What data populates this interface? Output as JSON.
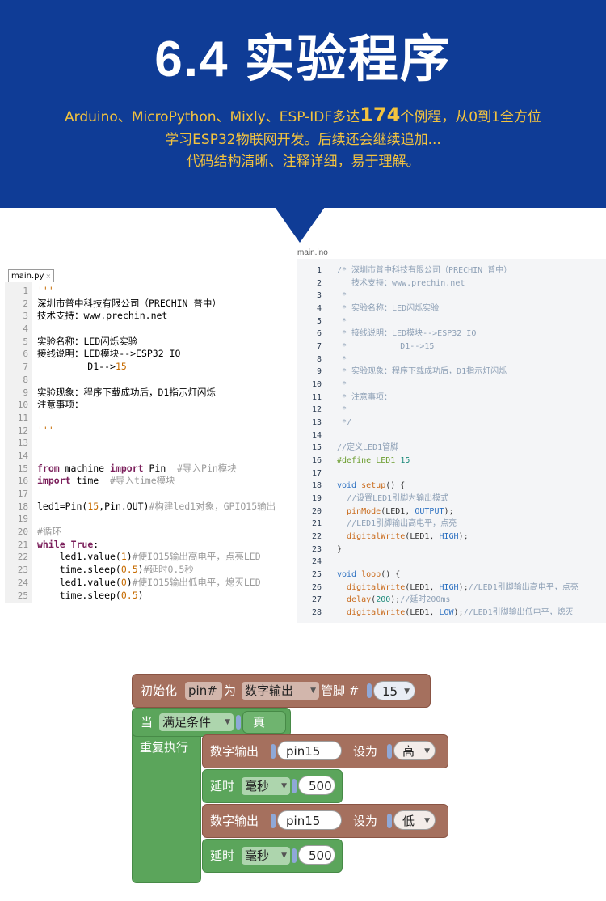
{
  "header": {
    "title": "6.4 实验程序",
    "subtitle_pre": "Arduino、MicroPython、Mixly、ESP-IDF多达",
    "subtitle_num": "174",
    "subtitle_post": "个例程，从0到1全方位",
    "line2": "学习ESP32物联网开发。后续还会继续追加...",
    "line3": "代码结构清晰、注释详细，易于理解。"
  },
  "python_editor": {
    "tab_label": "main.py",
    "lines": [
      {
        "n": "1",
        "code": "'''"
      },
      {
        "n": "2",
        "code": "深圳市普中科技有限公司（PRECHIN 普中）"
      },
      {
        "n": "3",
        "code": "技术支持：www.prechin.net"
      },
      {
        "n": "4",
        "code": ""
      },
      {
        "n": "5",
        "code": "实验名称：LED闪烁实验"
      },
      {
        "n": "6",
        "code": "接线说明：LED模块-->ESP32 IO"
      },
      {
        "n": "7",
        "code": "         D1-->15"
      },
      {
        "n": "8",
        "code": ""
      },
      {
        "n": "9",
        "code": "实验现象：程序下载成功后，D1指示灯闪烁"
      },
      {
        "n": "10",
        "code": "注意事项："
      },
      {
        "n": "11",
        "code": ""
      },
      {
        "n": "12",
        "code": "'''"
      },
      {
        "n": "13",
        "code": ""
      },
      {
        "n": "14",
        "code": ""
      },
      {
        "n": "15",
        "code": "from machine import Pin  #导入Pin模块"
      },
      {
        "n": "16",
        "code": "import time  #导入time模块"
      },
      {
        "n": "17",
        "code": ""
      },
      {
        "n": "18",
        "code": "led1=Pin(15,Pin.OUT)#构建led1对象，GPIO15输出"
      },
      {
        "n": "19",
        "code": ""
      },
      {
        "n": "20",
        "code": "#循环"
      },
      {
        "n": "21",
        "code": "while True:"
      },
      {
        "n": "22",
        "code": "    led1.value(1)#使IO15输出高电平，点亮LED"
      },
      {
        "n": "23",
        "code": "    time.sleep(0.5)#延时0.5秒"
      },
      {
        "n": "24",
        "code": "    led1.value(0)#使IO15输出低电平，熄灭LED"
      },
      {
        "n": "25",
        "code": "    time.sleep(0.5)"
      }
    ]
  },
  "arduino_editor": {
    "tab_label": "main.ino",
    "lines": [
      {
        "n": "1",
        "code": "/* 深圳市普中科技有限公司（PRECHIN 普中）"
      },
      {
        "n": "2",
        "code": "   技术支持：www.prechin.net"
      },
      {
        "n": "3",
        "code": " *"
      },
      {
        "n": "4",
        "code": " * 实验名称：LED闪烁实验"
      },
      {
        "n": "5",
        "code": " *"
      },
      {
        "n": "6",
        "code": " * 接线说明：LED模块-->ESP32 IO"
      },
      {
        "n": "7",
        "code": " *           D1-->15"
      },
      {
        "n": "8",
        "code": " *"
      },
      {
        "n": "9",
        "code": " * 实验现象：程序下载成功后，D1指示灯闪烁"
      },
      {
        "n": "10",
        "code": " *"
      },
      {
        "n": "11",
        "code": " * 注意事项："
      },
      {
        "n": "12",
        "code": " *"
      },
      {
        "n": "13",
        "code": " */"
      },
      {
        "n": "14",
        "code": ""
      },
      {
        "n": "15",
        "code": "//定义LED1管脚"
      },
      {
        "n": "16",
        "code": "#define LED1 15"
      },
      {
        "n": "17",
        "code": ""
      },
      {
        "n": "18",
        "code": "void setup() {"
      },
      {
        "n": "19",
        "code": "  //设置LED1引脚为输出模式"
      },
      {
        "n": "20",
        "code": "  pinMode(LED1, OUTPUT);"
      },
      {
        "n": "21",
        "code": "  //LED1引脚输出高电平，点亮"
      },
      {
        "n": "22",
        "code": "  digitalWrite(LED1, HIGH);"
      },
      {
        "n": "23",
        "code": "}"
      },
      {
        "n": "24",
        "code": ""
      },
      {
        "n": "25",
        "code": "void loop() {"
      },
      {
        "n": "26",
        "code": "  digitalWrite(LED1, HIGH);//LED1引脚输出高电平，点亮"
      },
      {
        "n": "27",
        "code": "  delay(200);//延时200ms"
      },
      {
        "n": "28",
        "code": "  digitalWrite(LED1, LOW);//LED1引脚输出低电平，熄灭"
      }
    ]
  },
  "blockly": {
    "init": {
      "label": "初始化",
      "var": "pin#",
      "as": "为",
      "mode": "数字输出",
      "pin_label": "管脚 #",
      "pin": "15"
    },
    "loop": {
      "when": "当",
      "cond": "满足条件",
      "value": "真",
      "repeat": "重复执行"
    },
    "write_high": {
      "label": "数字输出",
      "pin": "pin15",
      "set": "设为",
      "level": "高"
    },
    "delay1": {
      "label": "延时",
      "unit": "毫秒",
      "value": "500"
    },
    "write_low": {
      "label": "数字输出",
      "pin": "pin15",
      "set": "设为",
      "level": "低"
    },
    "delay2": {
      "label": "延时",
      "unit": "毫秒",
      "value": "500"
    }
  },
  "colors": {
    "banner": "#0f3c96",
    "subtitle": "#f3c33f",
    "block_io": "#a5705e",
    "block_control": "#5ba55b"
  }
}
